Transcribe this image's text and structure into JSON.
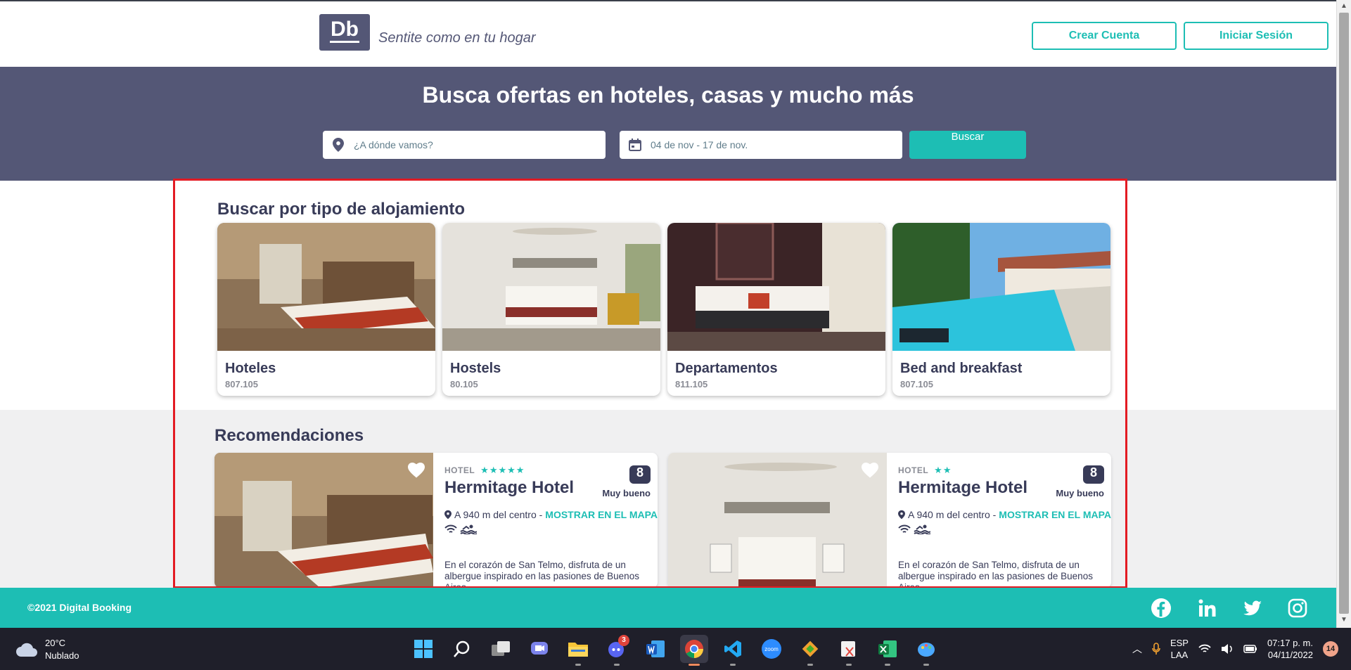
{
  "header": {
    "logo_text": "Db",
    "slogan": "Sentite como en tu hogar",
    "create_account": "Crear Cuenta",
    "login": "Iniciar Sesión"
  },
  "search": {
    "title": "Busca ofertas en hoteles, casas y mucho más",
    "destination_placeholder": "¿A dónde vamos?",
    "dates": "04 de nov - 17 de nov.",
    "button": "Buscar"
  },
  "types": {
    "title": "Buscar por tipo de alojamiento",
    "items": [
      {
        "name": "Hoteles",
        "count": "807.105"
      },
      {
        "name": "Hostels",
        "count": "80.105"
      },
      {
        "name": "Departamentos",
        "count": "811.105"
      },
      {
        "name": "Bed and breakfast",
        "count": "807.105"
      }
    ]
  },
  "recommendations": {
    "title": "Recomendaciones",
    "items": [
      {
        "category": "HOTEL",
        "stars": "★★★★★",
        "name": "Hermitage Hotel",
        "score": "8",
        "score_label": "Muy bueno",
        "location": "A 940 m del centro - ",
        "map_link": "MOSTRAR EN EL MAPA",
        "description": "En el corazón de San Telmo, disfruta de un albergue inspirado en las pasiones de Buenos Aires."
      },
      {
        "category": "HOTEL",
        "stars": "★★",
        "name": "Hermitage Hotel",
        "score": "8",
        "score_label": "Muy bueno",
        "location": "A 940 m del centro - ",
        "map_link": "MOSTRAR EN EL MAPA",
        "description": "En el corazón de San Telmo, disfruta de un albergue inspirado en las pasiones de Buenos Aires."
      }
    ]
  },
  "footer": {
    "copyright": "©2021 Digital Booking",
    "social_icons": [
      "facebook-icon",
      "linkedin-icon",
      "twitter-icon",
      "instagram-icon"
    ]
  },
  "taskbar": {
    "temperature": "20°C",
    "weather": "Nublado",
    "discord_badge": "3",
    "lang_top": "ESP",
    "lang_bottom": "LAA",
    "time": "07:17 p. m.",
    "date": "04/11/2022",
    "notifications": "14"
  },
  "colors": {
    "primary": "#545776",
    "accent": "#1dbeb4",
    "dark": "#383b58",
    "highlight": "#e31b23"
  }
}
